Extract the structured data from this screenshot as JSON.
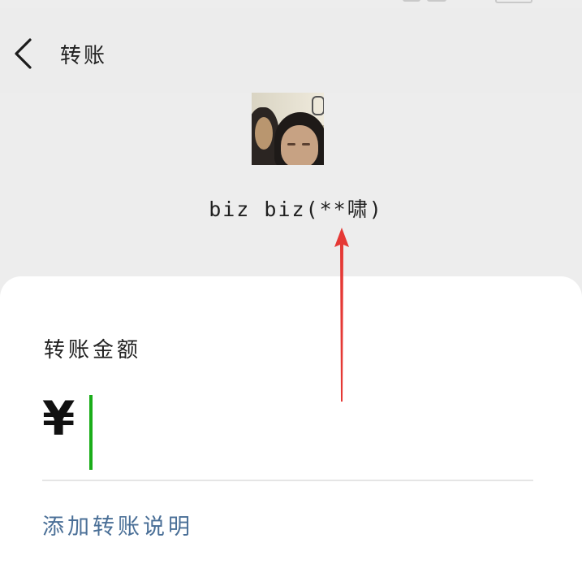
{
  "header": {
    "title": "转账",
    "back_icon": "chevron-left-icon"
  },
  "recipient": {
    "name": "biz biz(**啸)",
    "avatar_icon": "profile-photo"
  },
  "transfer": {
    "amount_label": "转账金额",
    "currency_symbol": "¥",
    "amount_value": "",
    "add_note_label": "添加转账说明",
    "accent_color": "#1aad19",
    "link_color": "#4a6f97"
  },
  "annotation": {
    "arrow_color": "#e53935",
    "arrow_icon": "red-arrow-up-icon"
  }
}
